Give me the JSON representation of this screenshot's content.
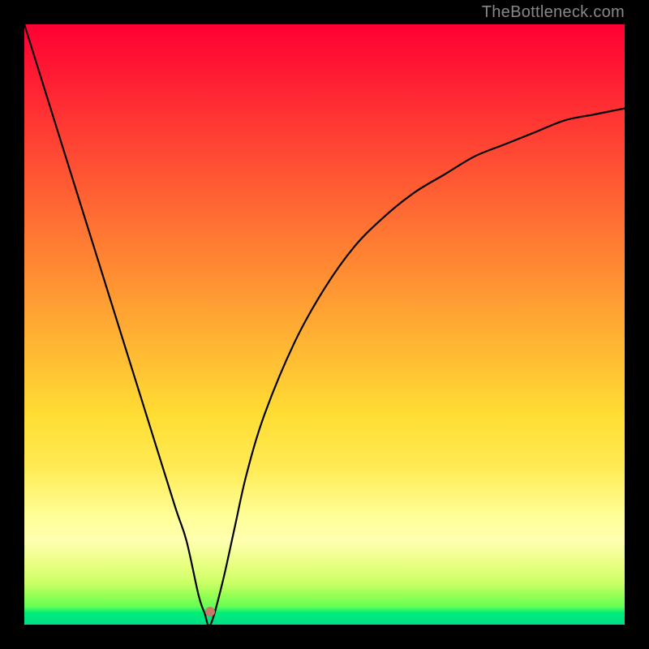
{
  "attribution": "TheBottleneck.com",
  "plot": {
    "dot": {
      "x_pct": 31.0,
      "y_pct": 97.8
    }
  },
  "chart_data": {
    "type": "line",
    "title": "",
    "xlabel": "",
    "ylabel": "",
    "xlim": [
      0,
      100
    ],
    "ylim": [
      0,
      100
    ],
    "series": [
      {
        "name": "curve",
        "x": [
          0,
          5,
          10,
          15,
          20,
          25,
          27,
          29,
          30,
          31,
          33,
          35,
          37,
          40,
          45,
          50,
          55,
          60,
          65,
          70,
          75,
          80,
          85,
          90,
          95,
          100
        ],
        "y": [
          100,
          84,
          68,
          52,
          36,
          20,
          14,
          5,
          2,
          0,
          7,
          16,
          25,
          35,
          47,
          56,
          63,
          68,
          72,
          75,
          78,
          80,
          82,
          84,
          85,
          86
        ]
      }
    ],
    "annotations": [
      {
        "type": "dot",
        "x": 31,
        "y": 2.2,
        "color": "#c87866"
      }
    ],
    "background_gradient": {
      "direction": "top-to-bottom",
      "stops": [
        {
          "pos": 0,
          "color": "#ff0033"
        },
        {
          "pos": 50,
          "color": "#ff9933"
        },
        {
          "pos": 82,
          "color": "#ffff99"
        },
        {
          "pos": 100,
          "color": "#00dd88"
        }
      ]
    }
  }
}
